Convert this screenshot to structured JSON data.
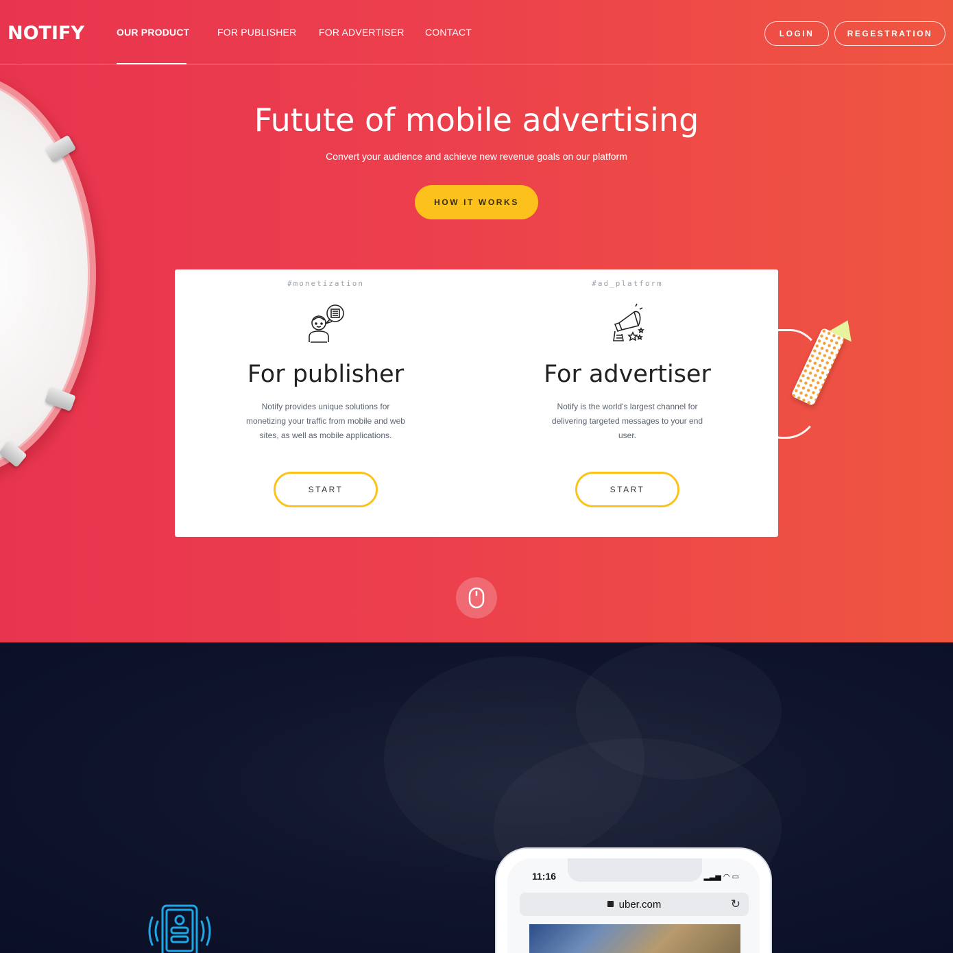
{
  "nav": {
    "logo": "NOTIFY",
    "links": [
      "OUR PRODUCT",
      "FOR PUBLISHER",
      "FOR ADVERTISER",
      "CONTACT"
    ],
    "login": "LOGIN",
    "register": "REGESTRATION"
  },
  "hero": {
    "title": "Futute of mobile advertising",
    "subtitle": "Convert your audience and achieve new revenue goals on our platform",
    "cta": "HOW IT WORKS"
  },
  "cards": [
    {
      "tag": "#monetization",
      "title": "For publisher",
      "text": "Notify provides unique solutions for monetizing your traffic from mobile and web sites, as well as mobile applications.",
      "button": "START",
      "icon": "publisher-person-icon"
    },
    {
      "tag": "#ad_platform",
      "title": "For advertiser",
      "text": "Notify is the world's largest channel for delivering targeted messages to your end user.",
      "button": "START",
      "icon": "megaphone-icon"
    }
  ],
  "phone": {
    "time": "11:16",
    "url": "uber.com"
  },
  "colors": {
    "hero_start": "#e8354f",
    "hero_end": "#ef5640",
    "accent": "#fcc21b",
    "dark_bg": "#0c1230",
    "notif_icon": "#1ea7e6"
  }
}
